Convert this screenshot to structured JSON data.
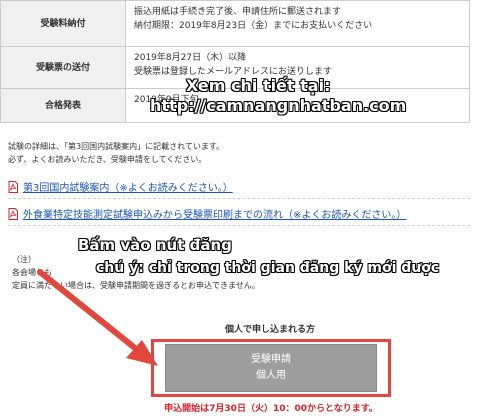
{
  "table": {
    "rows": [
      {
        "label": "受験料納付",
        "lines": [
          "振込用紙は手続き完了後、申請住所に郵送されます",
          "納付期限：2019年8月23日（金）までにお支払いください"
        ]
      },
      {
        "label": "受験票の送付",
        "lines": [
          "2019年8月27日（木）以降",
          "受験票は登録したメールアドレスにお送りします"
        ]
      },
      {
        "label": "合格発表",
        "lines": [
          "2019年9月下旬",
          ""
        ]
      }
    ]
  },
  "overlay": {
    "line1": "Xem chi tiết tại:",
    "line2": "http://camnangnhatban.com",
    "line3": "Bấm vào nút đăng",
    "line4": "chú ý: chỉ trong thời gian đăng ký mới được"
  },
  "notes": {
    "line1": "試験の詳細は、「第3回国内試験案内」に記載されています。",
    "line2": "必ず、よくお読みいただき、受験申請をしてください。"
  },
  "links": {
    "guide": "第3回国内試験案内（※よくお読みください。）",
    "flow": "外食業特定技能測定試験申込みから受験票印刷までの流れ（※よくお読みください。）"
  },
  "caution": {
    "heading": "（注）",
    "line1": "各会場とも",
    "line2": "定員に満たない場合は、受験申請期間を過ぎるとお申込できません。"
  },
  "apply": {
    "section_title": "個人で申し込まれる方",
    "button_line1": "受験申請",
    "button_line2": "個人用",
    "start_note": "申込開始は7月30日（火）10：00からとなります。"
  },
  "colors": {
    "link": "#1a56b8",
    "accent_red": "#e0483e",
    "button_gray": "#9e9e9e"
  },
  "icons": [
    "pdf-icon",
    "arrow"
  ]
}
